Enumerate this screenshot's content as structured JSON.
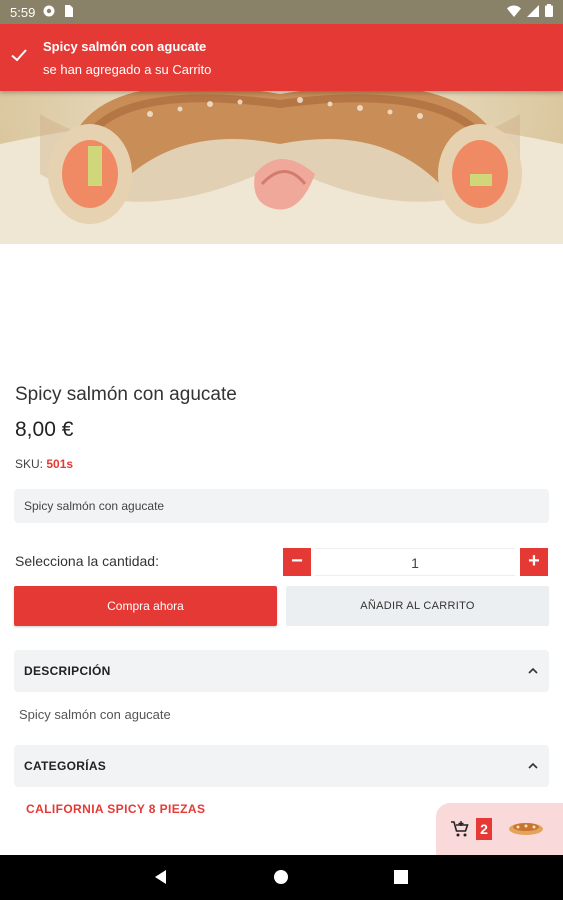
{
  "status_bar": {
    "time": "5:59",
    "left_icons": [
      "chrome-icon",
      "sim-icon"
    ],
    "right_icons": [
      "wifi-icon",
      "signal-icon",
      "battery-icon"
    ]
  },
  "toast": {
    "title": "Spicy salmón con agucate",
    "message": "se han agregado a su Carrito",
    "icon": "check-icon"
  },
  "product": {
    "title": "Spicy salmón con agucate",
    "price": "8,00 €",
    "sku_label": "SKU:",
    "sku_value": "501s",
    "variant": "Spicy salmón con agucate"
  },
  "quantity": {
    "label": "Selecciona la cantidad:",
    "value": "1",
    "minus": "−",
    "plus": "+"
  },
  "actions": {
    "buy_now": "Compra ahora",
    "add_to_cart": "AÑADIR AL CARRITO"
  },
  "description": {
    "header": "DESCRIPCIÓN",
    "text": "Spicy salmón con agucate"
  },
  "categories": {
    "header": "CATEGORÍAS",
    "items": [
      "CALIFORNIA SPICY 8 PIEZAS"
    ]
  },
  "cart": {
    "count": "2"
  },
  "colors": {
    "accent": "#e53935",
    "light_gray": "#f1f3f4",
    "cart_bg": "#f9d9d9"
  }
}
